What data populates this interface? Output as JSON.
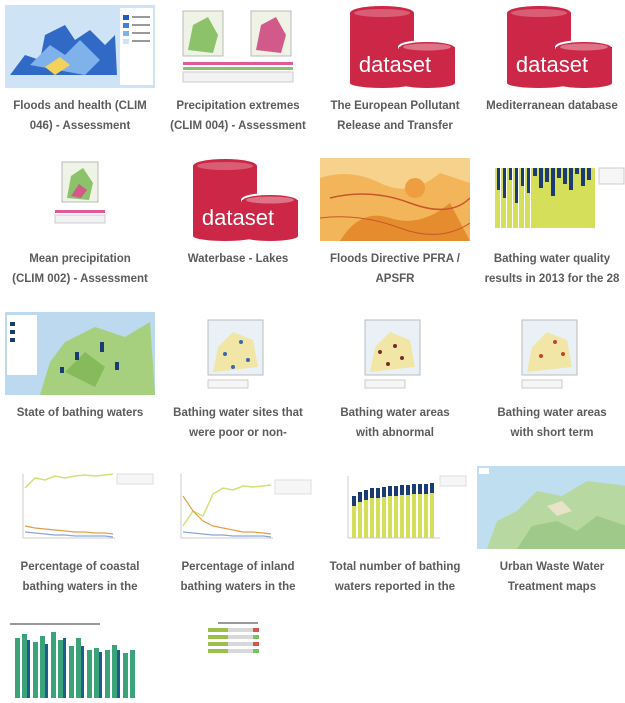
{
  "cards": [
    {
      "title": "Floods and health (CLIM\n046) - Assessment"
    },
    {
      "title": "Precipitation extremes\n(CLIM 004) - Assessment"
    },
    {
      "title": "The European Pollutant\nRelease and Transfer",
      "label": "dataset"
    },
    {
      "title": "Mediterranean database",
      "label": "dataset"
    },
    {
      "title": "Mean precipitation\n(CLIM 002) - Assessment"
    },
    {
      "title": "Waterbase - Lakes",
      "label": "dataset"
    },
    {
      "title": "Floods Directive PFRA /\nAPSFR"
    },
    {
      "title": "Bathing water quality\nresults in 2013 for the 28"
    },
    {
      "title": "State of bathing waters"
    },
    {
      "title": "Bathing water sites that\nwere poor or non-"
    },
    {
      "title": "Bathing water areas\nwith abnormal"
    },
    {
      "title": "Bathing water areas\nwith short term"
    },
    {
      "title": "Percentage of coastal\nbathing waters in the"
    },
    {
      "title": "Percentage of inland\nbathing waters in the"
    },
    {
      "title": "Total number of bathing\nwaters reported in the"
    },
    {
      "title": "Urban Waste Water\nTreatment maps"
    }
  ],
  "colors": {
    "dataset_red": "#cc2746",
    "map_blue": "#1f5bc0",
    "map_green": "#9fd07a",
    "bar_navy": "#1b3b73",
    "bar_yellow": "#d5df5a"
  }
}
